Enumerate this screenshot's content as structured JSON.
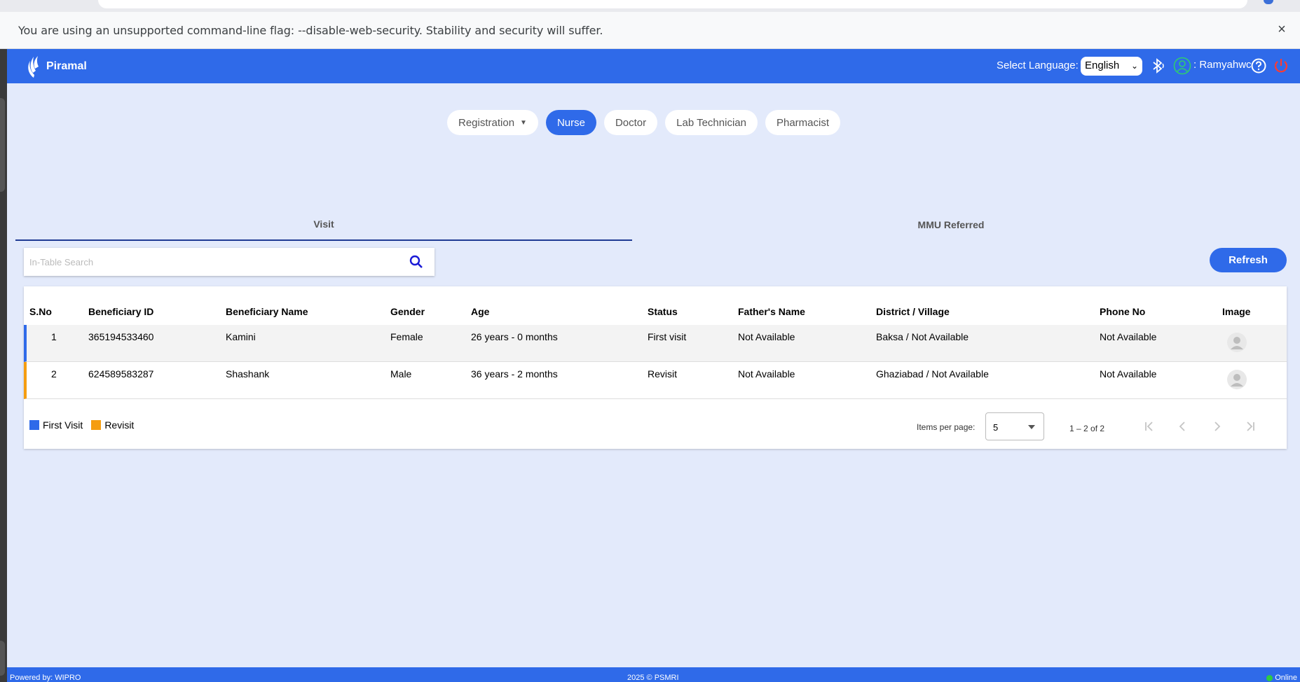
{
  "browser": {
    "warning_message": "You are using an unsupported command-line flag: --disable-web-security. Stability and security will suffer.",
    "close_symbol": "×"
  },
  "header": {
    "logo_text": "Piramal",
    "language_label": "Select Language:",
    "language_value": "English",
    "user_label": ": Ramyahwc",
    "icons": [
      "bluetooth-icon",
      "user-icon",
      "help-icon",
      "power-icon"
    ]
  },
  "roles": {
    "registration": "Registration",
    "nurse": "Nurse",
    "doctor": "Doctor",
    "lab_technician": "Lab Technician",
    "pharmacist": "Pharmacist",
    "active": "Nurse"
  },
  "sub_tabs": {
    "visit": "Visit",
    "mmu": "MMU Referred"
  },
  "search": {
    "placeholder": "In-Table Search"
  },
  "refresh_label": "Refresh",
  "table": {
    "headers": {
      "sno": "S.No",
      "beneficiary_id": "Beneficiary ID",
      "beneficiary_name": "Beneficiary Name",
      "gender": "Gender",
      "age": "Age",
      "status": "Status",
      "fathers_name": "Father's Name",
      "district_village": "District / Village",
      "phone_no": "Phone No",
      "image": "Image"
    },
    "rows": [
      {
        "sno": "1",
        "beneficiary_id": "365194533460",
        "beneficiary_name": "Kamini",
        "gender": "Female",
        "age": "26 years - 0 months",
        "status": "First visit",
        "fathers_name": "Not Available",
        "district_village": "Baksa / Not Available",
        "phone_no": "Not Available"
      },
      {
        "sno": "2",
        "beneficiary_id": "624589583287",
        "beneficiary_name": "Shashank",
        "gender": "Male",
        "age": "36 years - 2 months",
        "status": "Revisit",
        "fathers_name": "Not Available",
        "district_village": "Ghaziabad / Not Available",
        "phone_no": "Not Available"
      }
    ]
  },
  "legend": {
    "first_visit": "First Visit",
    "revisit": "Revisit",
    "first_visit_color": "#2f6ae9",
    "revisit_color": "#f59d10"
  },
  "pagination": {
    "items_per_page_label": "Items per page:",
    "items_per_page_value": "5",
    "range_label": "1 – 2 of 2"
  },
  "footer": {
    "powered_by": "Powered by: WIPRO",
    "copyright": "2025 © PSMRI",
    "status": "Online"
  },
  "colors": {
    "primary": "#2f6ae9",
    "background": "#e3eafb"
  }
}
